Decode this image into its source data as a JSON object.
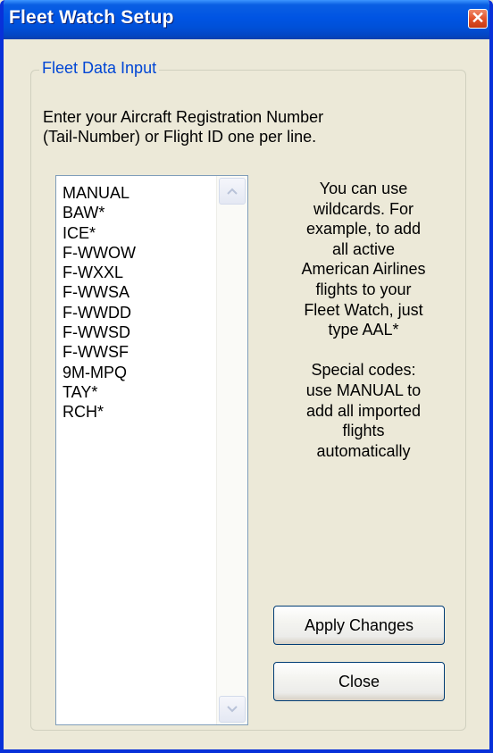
{
  "window": {
    "title": "Fleet Watch Setup",
    "close_glyph": "✕",
    "accent_color": "#0054e3"
  },
  "group": {
    "label": "Fleet Data Input",
    "label_color": "#0046d5"
  },
  "instructions": {
    "line1": "Enter your Aircraft Registration Number",
    "line2": " (Tail-Number) or Flight ID one per line."
  },
  "fleet_list": {
    "items": [
      "MANUAL",
      "BAW*",
      "ICE*",
      "F-WWOW",
      "F-WXXL",
      "F-WWSA",
      "F-WWDD",
      "F-WWSD",
      "F-WWSF",
      "9M-MPQ",
      "TAY*",
      "RCH*"
    ],
    "scroll_up_icon": "chevron-up-icon",
    "scroll_down_icon": "chevron-down-icon"
  },
  "help": {
    "lines": [
      "You can use",
      "wildcards. For",
      "example, to add",
      "all active",
      "American Airlines",
      "flights to your",
      "Fleet Watch, just",
      "type AAL*"
    ],
    "special_lines": [
      "Special codes:",
      "use MANUAL to",
      "add all imported",
      "flights",
      "automatically"
    ]
  },
  "buttons": {
    "apply_label": "Apply Changes",
    "close_label": "Close"
  }
}
